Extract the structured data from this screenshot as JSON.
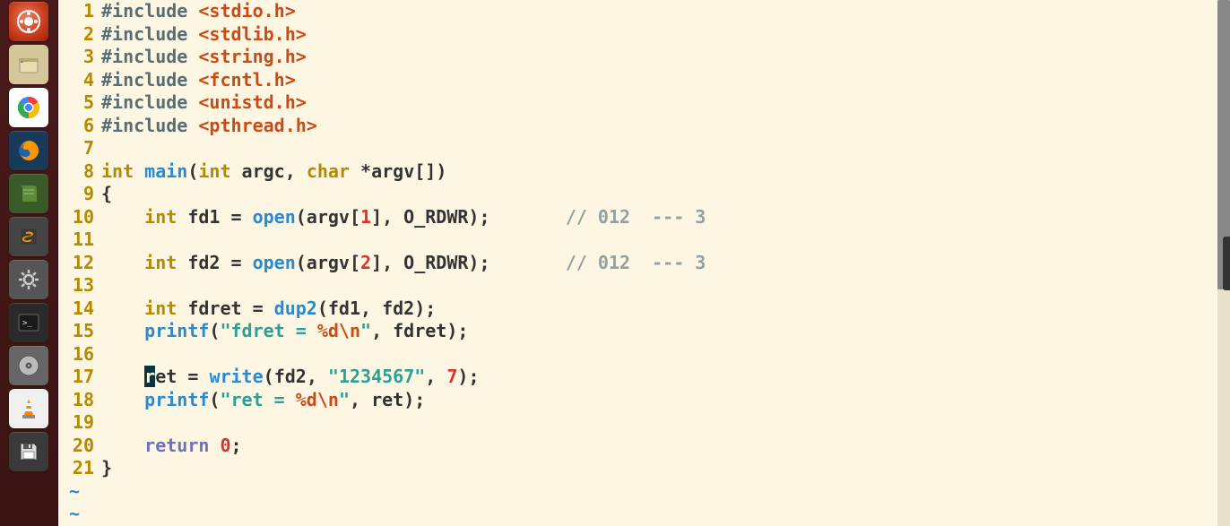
{
  "launcher": {
    "items": [
      {
        "name": "dash-icon"
      },
      {
        "name": "files-icon"
      },
      {
        "name": "chrome-icon"
      },
      {
        "name": "firefox-icon"
      },
      {
        "name": "book-icon"
      },
      {
        "name": "sublime-icon"
      },
      {
        "name": "settings-icon"
      },
      {
        "name": "terminal-icon"
      },
      {
        "name": "disk-icon"
      },
      {
        "name": "vlc-icon"
      },
      {
        "name": "save-icon"
      }
    ]
  },
  "editor": {
    "cursor_line": 17,
    "cursor_col": 4,
    "cursor_char": "r",
    "tilde_count": 2,
    "lines": [
      {
        "n": 1,
        "tokens": [
          {
            "t": "#include ",
            "c": "include"
          },
          {
            "t": "<stdio.h>",
            "c": "preproc"
          }
        ]
      },
      {
        "n": 2,
        "tokens": [
          {
            "t": "#include ",
            "c": "include"
          },
          {
            "t": "<stdlib.h>",
            "c": "preproc"
          }
        ]
      },
      {
        "n": 3,
        "tokens": [
          {
            "t": "#include ",
            "c": "include"
          },
          {
            "t": "<string.h>",
            "c": "preproc"
          }
        ]
      },
      {
        "n": 4,
        "tokens": [
          {
            "t": "#include ",
            "c": "include"
          },
          {
            "t": "<fcntl.h>",
            "c": "preproc"
          }
        ]
      },
      {
        "n": 5,
        "tokens": [
          {
            "t": "#include ",
            "c": "include"
          },
          {
            "t": "<unistd.h>",
            "c": "preproc"
          }
        ]
      },
      {
        "n": 6,
        "tokens": [
          {
            "t": "#include ",
            "c": "include"
          },
          {
            "t": "<pthread.h>",
            "c": "preproc"
          }
        ]
      },
      {
        "n": 7,
        "tokens": []
      },
      {
        "n": 8,
        "tokens": [
          {
            "t": "int",
            "c": "type"
          },
          {
            "t": " ",
            "c": ""
          },
          {
            "t": "main",
            "c": "func"
          },
          {
            "t": "(",
            "c": ""
          },
          {
            "t": "int",
            "c": "type"
          },
          {
            "t": " argc, ",
            "c": ""
          },
          {
            "t": "char",
            "c": "type"
          },
          {
            "t": " *argv[])",
            "c": ""
          }
        ]
      },
      {
        "n": 9,
        "tokens": [
          {
            "t": "{",
            "c": ""
          }
        ]
      },
      {
        "n": 10,
        "tokens": [
          {
            "t": "    ",
            "c": ""
          },
          {
            "t": "int",
            "c": "type"
          },
          {
            "t": " fd1 = ",
            "c": ""
          },
          {
            "t": "open",
            "c": "func"
          },
          {
            "t": "(argv[",
            "c": ""
          },
          {
            "t": "1",
            "c": "number"
          },
          {
            "t": "], O_RDWR);       ",
            "c": ""
          },
          {
            "t": "// 012  --- 3",
            "c": "comment"
          }
        ]
      },
      {
        "n": 11,
        "tokens": []
      },
      {
        "n": 12,
        "tokens": [
          {
            "t": "    ",
            "c": ""
          },
          {
            "t": "int",
            "c": "type"
          },
          {
            "t": " fd2 = ",
            "c": ""
          },
          {
            "t": "open",
            "c": "func"
          },
          {
            "t": "(argv[",
            "c": ""
          },
          {
            "t": "2",
            "c": "number"
          },
          {
            "t": "], O_RDWR);       ",
            "c": ""
          },
          {
            "t": "// 012  --- 3",
            "c": "comment"
          }
        ]
      },
      {
        "n": 13,
        "tokens": []
      },
      {
        "n": 14,
        "tokens": [
          {
            "t": "    ",
            "c": ""
          },
          {
            "t": "int",
            "c": "type"
          },
          {
            "t": " fdret = ",
            "c": ""
          },
          {
            "t": "dup2",
            "c": "func"
          },
          {
            "t": "(fd1, fd2);",
            "c": ""
          }
        ]
      },
      {
        "n": 15,
        "tokens": [
          {
            "t": "    ",
            "c": ""
          },
          {
            "t": "printf",
            "c": "func"
          },
          {
            "t": "(",
            "c": ""
          },
          {
            "t": "\"fdret = ",
            "c": "string"
          },
          {
            "t": "%d\\n",
            "c": "escape"
          },
          {
            "t": "\"",
            "c": "string"
          },
          {
            "t": ", fdret);",
            "c": ""
          }
        ]
      },
      {
        "n": 16,
        "tokens": []
      },
      {
        "n": 17,
        "tokens": [
          {
            "t": "    ",
            "c": ""
          },
          {
            "t": "r",
            "c": "cursor"
          },
          {
            "t": "et = ",
            "c": ""
          },
          {
            "t": "write",
            "c": "func"
          },
          {
            "t": "(fd2, ",
            "c": ""
          },
          {
            "t": "\"1234567\"",
            "c": "string"
          },
          {
            "t": ", ",
            "c": ""
          },
          {
            "t": "7",
            "c": "number"
          },
          {
            "t": ");",
            "c": ""
          }
        ]
      },
      {
        "n": 18,
        "tokens": [
          {
            "t": "    ",
            "c": ""
          },
          {
            "t": "printf",
            "c": "func"
          },
          {
            "t": "(",
            "c": ""
          },
          {
            "t": "\"ret = ",
            "c": "string"
          },
          {
            "t": "%d\\n",
            "c": "escape"
          },
          {
            "t": "\"",
            "c": "string"
          },
          {
            "t": ", ret);",
            "c": ""
          }
        ]
      },
      {
        "n": 19,
        "tokens": []
      },
      {
        "n": 20,
        "tokens": [
          {
            "t": "    ",
            "c": ""
          },
          {
            "t": "return",
            "c": "keyword"
          },
          {
            "t": " ",
            "c": ""
          },
          {
            "t": "0",
            "c": "number"
          },
          {
            "t": ";",
            "c": ""
          }
        ]
      },
      {
        "n": 21,
        "tokens": [
          {
            "t": "}",
            "c": ""
          }
        ]
      }
    ]
  }
}
